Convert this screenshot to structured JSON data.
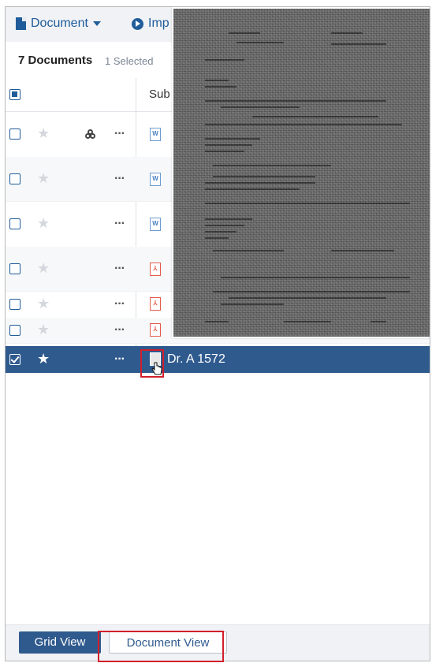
{
  "toolbar": {
    "document_label": "Document",
    "import_label": "Imp"
  },
  "summary": {
    "count_label": "7 Documents",
    "selected_label": "1 Selected"
  },
  "table": {
    "header_subject": "Sub",
    "rows": [
      {
        "type": "word",
        "linked": true,
        "starred": false,
        "checked": false
      },
      {
        "type": "word",
        "linked": false,
        "starred": false,
        "checked": false
      },
      {
        "type": "word",
        "linked": false,
        "starred": false,
        "checked": false
      },
      {
        "type": "pdf",
        "linked": false,
        "starred": false,
        "checked": false
      },
      {
        "type": "pdf",
        "linked": false,
        "starred": false,
        "checked": false
      },
      {
        "type": "pdf",
        "linked": false,
        "starred": false,
        "checked": false
      },
      {
        "type": "image",
        "linked": false,
        "starred": true,
        "checked": true,
        "name": "Dr. A 1572"
      }
    ]
  },
  "icons": {
    "word": "W",
    "pdf": "PDF",
    "more": "···",
    "star": "★"
  },
  "footer": {
    "grid_view_label": "Grid View",
    "document_view_label": "Document View"
  },
  "colors": {
    "accent": "#2f5a8e",
    "highlight": "#d21f2b"
  }
}
